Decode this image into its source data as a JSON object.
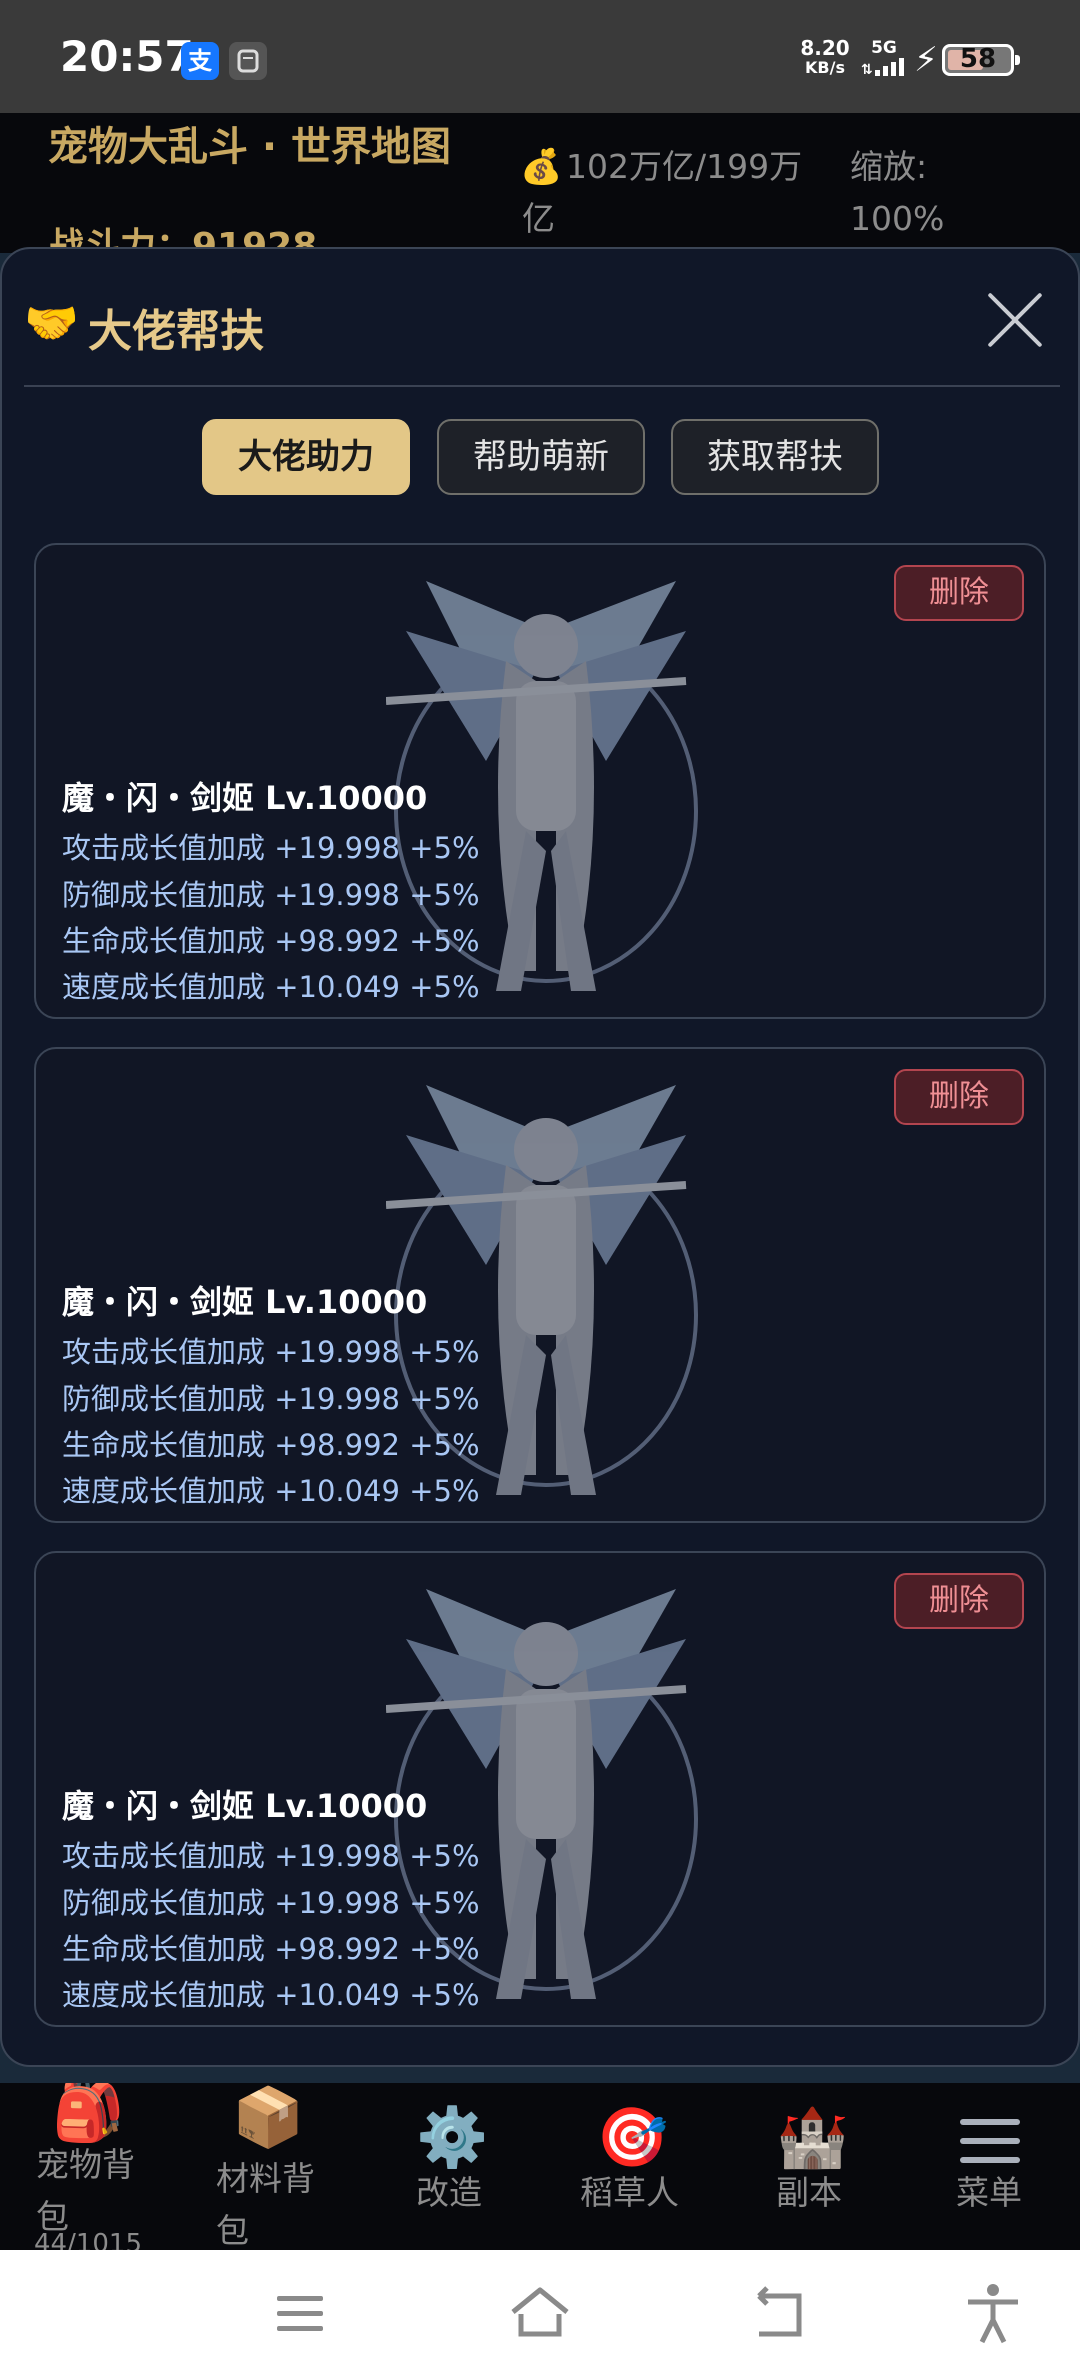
{
  "status_bar": {
    "time": "20:57",
    "alipay_icon_text": "支",
    "app_icon": "app-notification-icon",
    "net_speed_value": "8.20",
    "net_speed_unit": "KB/s",
    "network": "5G",
    "battery": "58",
    "battery_level": 0.58
  },
  "header": {
    "title": "宠物大乱斗 · 世界地图",
    "power": "战斗力：91928",
    "money": "102万亿/199万亿",
    "zoom": "缩放: 100%"
  },
  "modal": {
    "title": "大佬帮扶",
    "title_icon": "handshake-icon",
    "tabs": [
      {
        "label": "大佬助力",
        "active": true
      },
      {
        "label": "帮助萌新",
        "active": false
      },
      {
        "label": "获取帮扶",
        "active": false
      }
    ],
    "cards": [
      {
        "name": "魔・闪・剑姬 Lv.10000",
        "delete_label": "删除",
        "stats": [
          "攻击成长值加成 +19.998 +5%",
          "防御成长值加成 +19.998 +5%",
          "生命成长值加成 +98.992 +5%",
          "速度成长值加成 +10.049 +5%"
        ]
      },
      {
        "name": "魔・闪・剑姬 Lv.10000",
        "delete_label": "删除",
        "stats": [
          "攻击成长值加成 +19.998 +5%",
          "防御成长值加成 +19.998 +5%",
          "生命成长值加成 +98.992 +5%",
          "速度成长值加成 +10.049 +5%"
        ]
      },
      {
        "name": "魔・闪・剑姬 Lv.10000",
        "delete_label": "删除",
        "stats": [
          "攻击成长值加成 +19.998 +5%",
          "防御成长值加成 +19.998 +5%",
          "生命成长值加成 +98.992 +5%",
          "速度成长值加成 +10.049 +5%"
        ]
      }
    ]
  },
  "bottom_nav": [
    {
      "label": "宠物背包",
      "icon": "backpack-icon",
      "count": "44/1015"
    },
    {
      "label": "材料背包",
      "icon": "box-icon"
    },
    {
      "label": "改造",
      "icon": "gear-icon"
    },
    {
      "label": "稻草人",
      "icon": "target-icon"
    },
    {
      "label": "副本",
      "icon": "castle-icon"
    },
    {
      "label": "菜单",
      "icon": "menu-icon"
    }
  ],
  "system_nav": [
    "recent-apps-icon",
    "home-icon",
    "back-icon",
    "accessibility-icon"
  ],
  "colors": {
    "accent_gold": "#e3c787",
    "stat_blue": "#a9c7f4",
    "delete_red": "#ef8f94",
    "modal_bg": "#101728"
  }
}
